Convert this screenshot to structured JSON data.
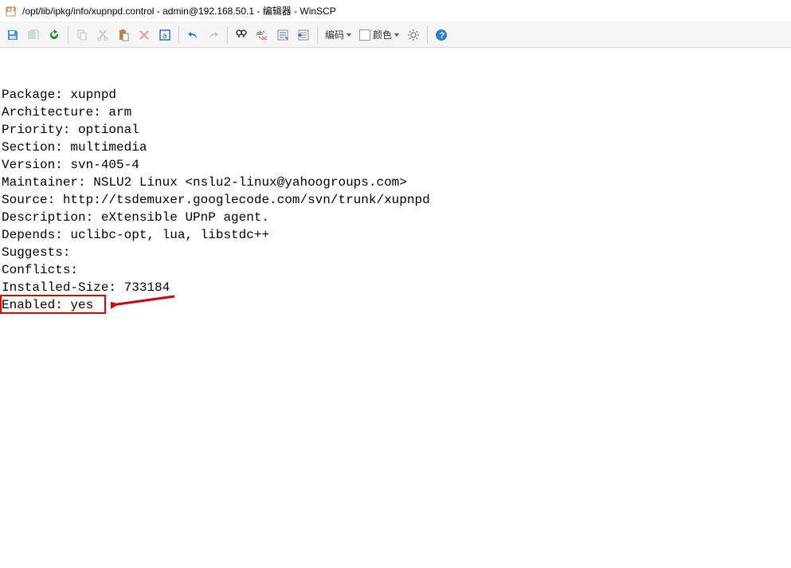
{
  "window": {
    "title": "/opt/lib/ipkg/info/xupnpd.control - admin@192.168.50.1 - 编辑器 - WinSCP"
  },
  "toolbar": {
    "encoding_label": "编码",
    "color_label": "颜色"
  },
  "file": {
    "lines": [
      "Package: xupnpd",
      "Architecture: arm",
      "Priority: optional",
      "Section: multimedia",
      "Version: svn-405-4",
      "Maintainer: NSLU2 Linux <nslu2-linux@yahoogroups.com>",
      "Source: http://tsdemuxer.googlecode.com/svn/trunk/xupnpd",
      "Description: eXtensible UPnP agent.",
      "Depends: uclibc-opt, lua, libstdc++",
      "Suggests:",
      "Conflicts:",
      "Installed-Size: 733184",
      "Enabled: yes"
    ]
  },
  "annotation": {
    "highlight_line_index": 12
  }
}
